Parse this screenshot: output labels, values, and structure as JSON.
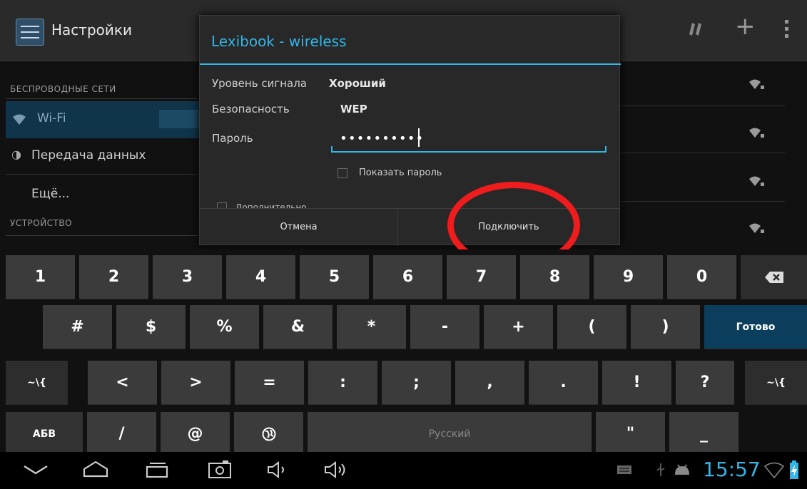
{
  "app": {
    "title": "Настройки"
  },
  "settings": {
    "section_wireless": "БЕСПРОВОДНЫЕ СЕТИ",
    "wifi_label": "Wi-Fi",
    "data_usage_label": "Передача данных",
    "more_label": "Ещё...",
    "section_device": "УСТРОЙСТВО"
  },
  "dialog": {
    "title": "Lexibook - wireless",
    "signal_label": "Уровень сигнала",
    "signal_value": "Хороший",
    "security_label": "Безопасность",
    "security_value": "WEP",
    "password_label": "Пароль",
    "password_masked": "••••••••••",
    "show_password_label": "Показать пароль",
    "advanced_label": "Дополнительно",
    "cancel_label": "Отмена",
    "connect_label": "Подключить"
  },
  "keyboard": {
    "row1": [
      "1",
      "2",
      "3",
      "4",
      "5",
      "6",
      "7",
      "8",
      "9",
      "0"
    ],
    "delete_icon": "backspace-icon",
    "row2": [
      "#",
      "$",
      "%",
      "&",
      "*",
      "-",
      "+",
      "(",
      ")"
    ],
    "done_label": "Готово",
    "row3_left": "~\\{",
    "row3": [
      "<",
      ">",
      "=",
      ":",
      ";",
      ",",
      "."
    ],
    "row3_extra": [
      "!",
      "?"
    ],
    "row3_right": "~\\{",
    "abc_label": "АБВ",
    "slash": "/",
    "at": "@",
    "globe_icon": "globe-icon",
    "space_label": "Русский",
    "quote": "\"",
    "underscore": "_"
  },
  "status": {
    "time": "15:57"
  },
  "colors": {
    "accent": "#33b5e5",
    "annotation": "#ee1c1c",
    "done_key": "#0b3e5c"
  }
}
